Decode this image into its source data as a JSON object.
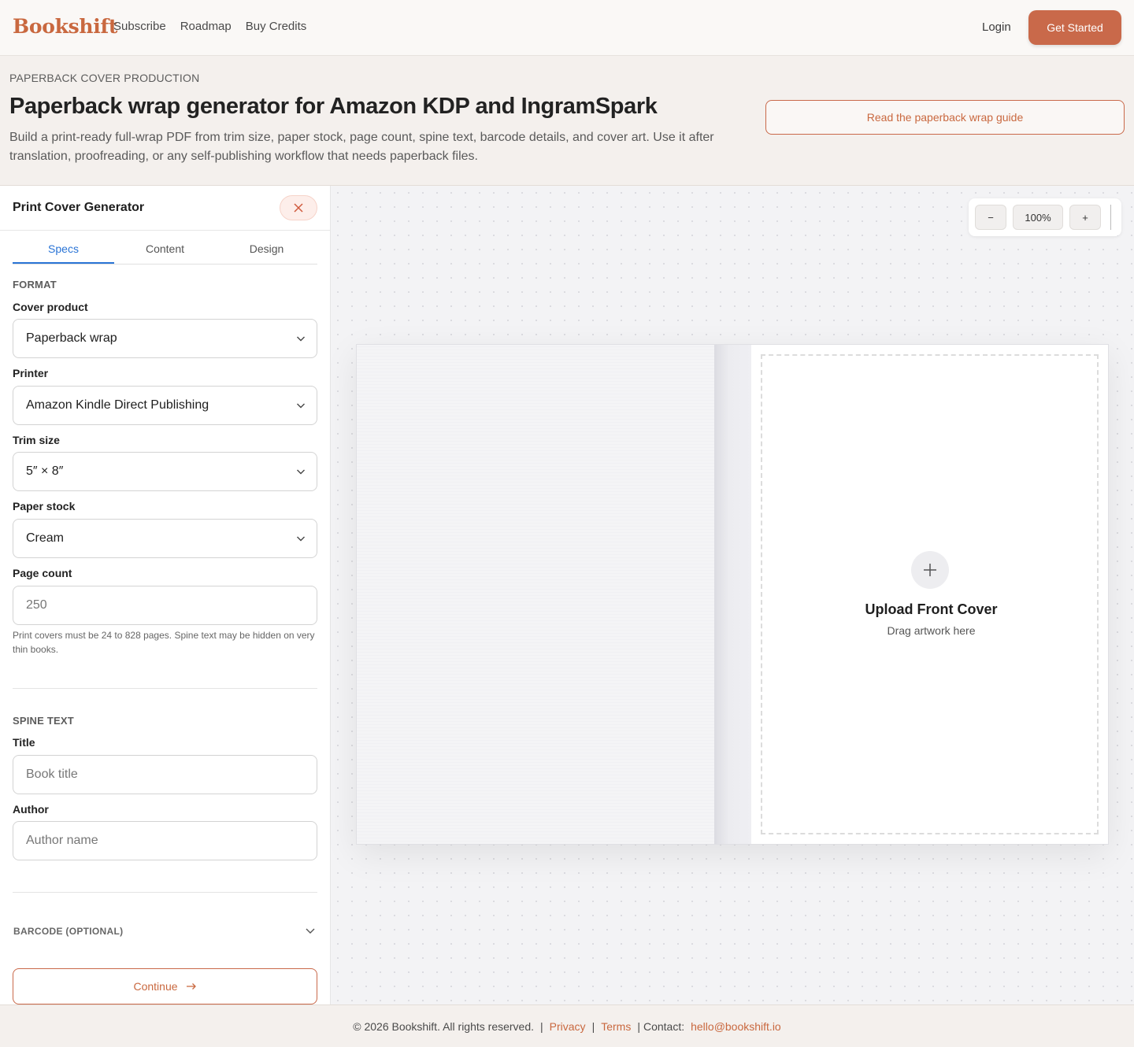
{
  "nav": {
    "brand": "Bookshift",
    "links": [
      "Subscribe",
      "Roadmap",
      "Buy Credits"
    ],
    "login": "Login",
    "cta": "Get Started"
  },
  "hero": {
    "eyebrow": "PAPERBACK COVER PRODUCTION",
    "title": "Paperback wrap generator for Amazon KDP and IngramSpark",
    "description": "Build a print-ready full-wrap PDF from trim size, paper stock, page count, spine text, barcode details, and cover art. Use it after translation, proofreading, or any self-publishing workflow that needs paperback files.",
    "guide_button": "Read the paperback wrap guide"
  },
  "sidebar": {
    "title": "Print Cover Generator",
    "tabs": [
      "Specs",
      "Content",
      "Design"
    ],
    "active_tab": "Specs",
    "format": {
      "section": "FORMAT",
      "cover_product_label": "Cover product",
      "cover_product_value": "Paperback wrap",
      "printer_label": "Printer",
      "printer_value": "Amazon Kindle Direct Publishing",
      "trim_label": "Trim size",
      "trim_value": "5″ × 8″",
      "paper_label": "Paper stock",
      "paper_value": "Cream",
      "page_count_label": "Page count",
      "page_count_placeholder": "250",
      "help": "Print covers must be 24 to 828 pages. Spine text may be hidden on very thin books."
    },
    "spine": {
      "section": "SPINE TEXT",
      "title_label": "Title",
      "title_placeholder": "Book title",
      "author_label": "Author",
      "author_placeholder": "Author name"
    },
    "barcode_label": "BARCODE (OPTIONAL)",
    "continue_label": "Continue"
  },
  "canvas": {
    "zoom_out": "−",
    "zoom_level": "100%",
    "zoom_in": "+",
    "upload_title": "Upload Front Cover",
    "upload_sub": "Drag artwork here"
  },
  "footer": {
    "copyright": "© 2026 Bookshift. All rights reserved.",
    "privacy": "Privacy",
    "terms": "Terms",
    "contact_label": "Contact:",
    "email": "hello@bookshift.io"
  },
  "colors": {
    "accent": "#c9694a",
    "tab_active": "#2a74d6"
  }
}
